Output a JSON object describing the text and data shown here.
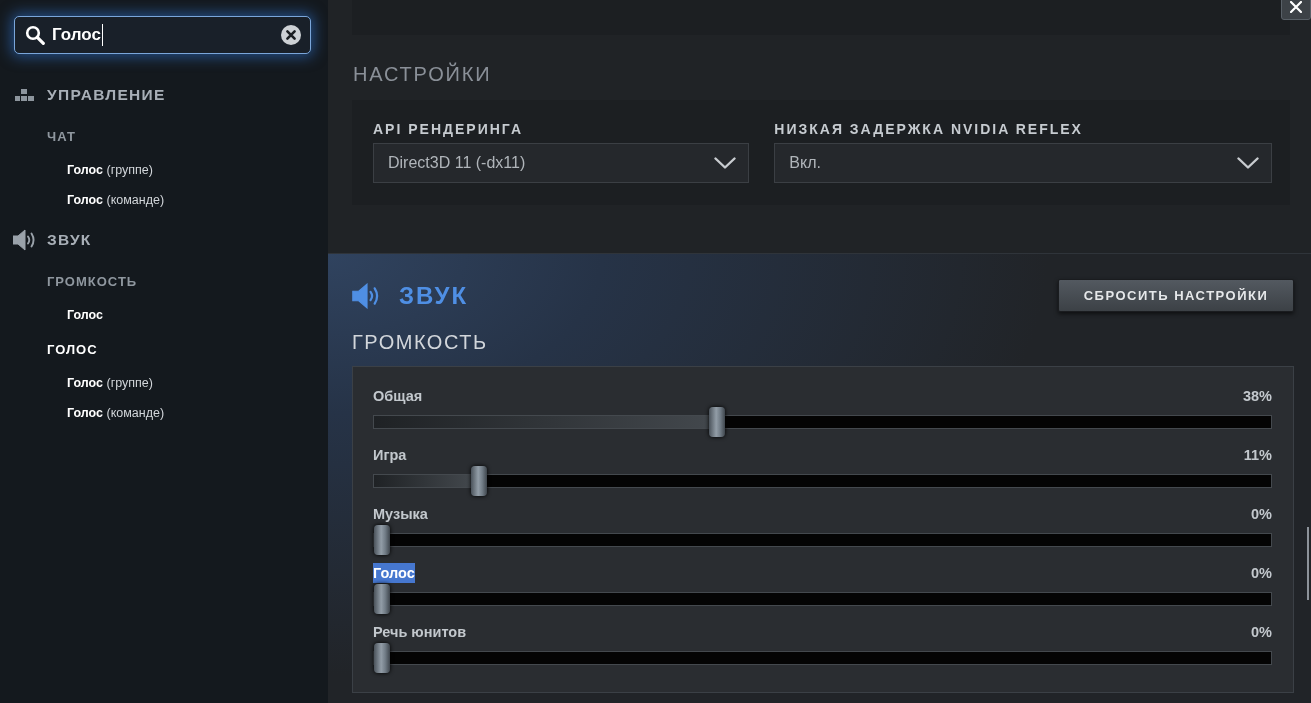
{
  "search": {
    "value": "Голос"
  },
  "sidebar": {
    "sections": [
      {
        "kind": "controls",
        "title": "УПРАВЛЕНИЕ",
        "children": [
          {
            "title": "ЧАТ",
            "highlighted": false,
            "children": [
              {
                "label": "**Голос** (группе)",
                "highlighted": false
              },
              {
                "label": "**Голос** (команде)",
                "highlighted": false
              }
            ]
          }
        ]
      },
      {
        "kind": "sound",
        "title": "ЗВУК",
        "children": [
          {
            "title": "ГРОМКОСТЬ",
            "highlighted": false,
            "children": [
              {
                "label": "Голос",
                "highlighted": true
              }
            ]
          },
          {
            "title": "ГОЛОС",
            "highlighted": true,
            "children": [
              {
                "label": "**Голос** (группе)",
                "highlighted": false
              },
              {
                "label": "**Голос** (команде)",
                "highlighted": false
              }
            ]
          }
        ]
      }
    ]
  },
  "settings": {
    "title": "НАСТРОЙКИ",
    "fields": [
      {
        "label": "API РЕНДЕРИНГА",
        "value": "Direct3D 11 (-dx11)"
      },
      {
        "label": "НИЗКАЯ ЗАДЕРЖКА NVIDIA REFLEX",
        "value": "Вкл."
      }
    ]
  },
  "sound": {
    "title": "ЗВУК",
    "reset_button": "СБРОСИТЬ НАСТРОЙКИ",
    "volume": {
      "title": "ГРОМКОСТЬ",
      "sliders": [
        {
          "label": "Общая",
          "value": "38%",
          "level": 0.38,
          "highlighted": false
        },
        {
          "label": "Игра",
          "value": "11%",
          "level": 0.11,
          "highlighted": false
        },
        {
          "label": "Музыка",
          "value": "0%",
          "level": 0,
          "highlighted": false
        },
        {
          "label": "Голос",
          "value": "0%",
          "level": 0,
          "highlighted": true
        },
        {
          "label": "Речь юнитов",
          "value": "0%",
          "level": 0,
          "highlighted": false
        }
      ]
    }
  }
}
